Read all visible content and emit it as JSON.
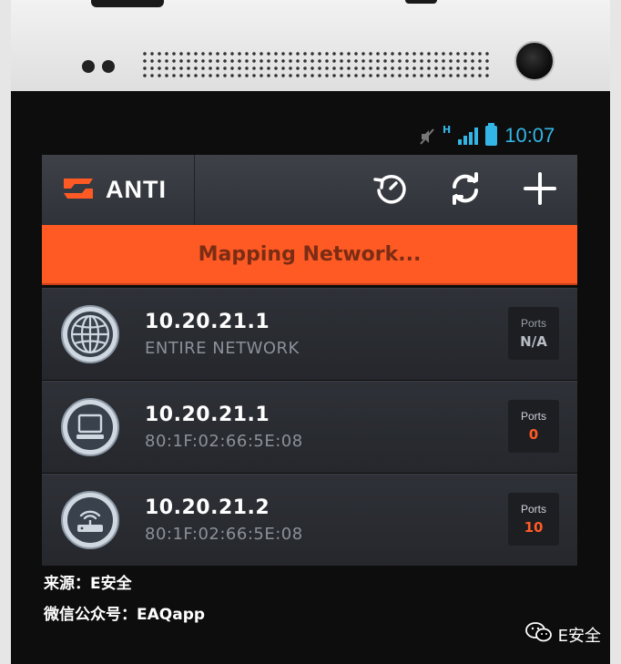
{
  "status_bar": {
    "time": "10:07",
    "network_type": "H",
    "accent_color": "#33b5e5"
  },
  "app_bar": {
    "title": "ANTI",
    "actions": [
      {
        "icon": "history-icon"
      },
      {
        "icon": "refresh-icon"
      },
      {
        "icon": "add-icon"
      }
    ]
  },
  "banner": {
    "text": "Mapping Network...",
    "color": "#ff5a24"
  },
  "devices": [
    {
      "icon": "globe-icon",
      "ip": "10.20.21.1",
      "subtitle": "ENTIRE NETWORK",
      "ports_label": "Ports",
      "ports_value": "N/A"
    },
    {
      "icon": "computer-icon",
      "ip": "10.20.21.1",
      "subtitle": "80:1F:02:66:5E:08",
      "ports_label": "Ports",
      "ports_value": "0"
    },
    {
      "icon": "router-icon",
      "ip": "10.20.21.2",
      "subtitle": "80:1F:02:66:5E:08",
      "ports_label": "Ports",
      "ports_value": "10"
    }
  ],
  "watermark": {
    "source_line": "来源：E安全",
    "wechat_line": "微信公众号：EAQapp",
    "brand": "E安全"
  }
}
